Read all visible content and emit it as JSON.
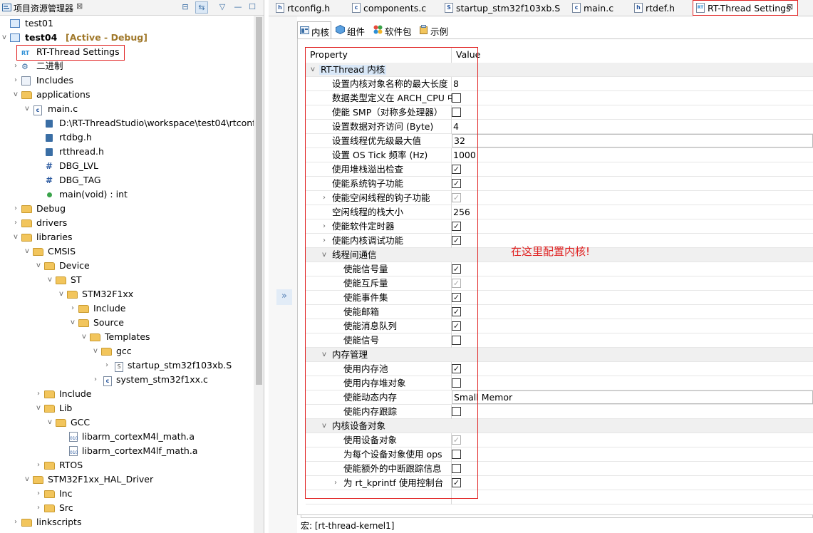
{
  "explorer": {
    "title": "项目资源管理器",
    "close_glyph": "⊠",
    "toolbar": [
      {
        "icon": "collapse-all-icon",
        "glyph": "⊟"
      },
      {
        "icon": "link-with-editor-icon",
        "glyph": "⇆"
      },
      {
        "icon": "view-menu-icon",
        "glyph": "▽"
      },
      {
        "icon": "minimize-icon",
        "glyph": "—"
      },
      {
        "icon": "maximize-icon",
        "glyph": "☐"
      }
    ],
    "tree": {
      "test01": "test01",
      "test04": "test04",
      "test04_status": "[Active - Debug]",
      "rt_settings": "RT-Thread Settings",
      "rt_logo": "RT",
      "binaries": "二进制",
      "includes": "Includes",
      "applications": "applications",
      "main_c": "main.c",
      "rtconfig_path": "D:\\RT-ThreadStudio\\workspace\\test04\\rtconfig",
      "rtdbg_h": "rtdbg.h",
      "rtthread_h": "rtthread.h",
      "dbg_lvl": "DBG_LVL",
      "dbg_tag": "DBG_TAG",
      "main_void": "main(void) : int",
      "debug": "Debug",
      "drivers": "drivers",
      "libraries": "libraries",
      "cmsis": "CMSIS",
      "device": "Device",
      "st": "ST",
      "stm32f1xx": "STM32F1xx",
      "include_sub": "Include",
      "source": "Source",
      "templates": "Templates",
      "gcc_lower": "gcc",
      "startup_s": "startup_stm32f103xb.S",
      "system_c": "system_stm32f1xx.c",
      "include_cmsis": "Include",
      "lib": "Lib",
      "gcc_upper": "GCC",
      "libarm_m4l": "libarm_cortexM4l_math.a",
      "libarm_m4lf": "libarm_cortexM4lf_math.a",
      "rtos": "RTOS",
      "hal_driver": "STM32F1xx_HAL_Driver",
      "inc": "Inc",
      "src": "Src",
      "linkscripts": "linkscripts"
    }
  },
  "editor_tabs": [
    {
      "icon": "h",
      "label": "rtconfig.h"
    },
    {
      "icon": "c",
      "label": "components.c"
    },
    {
      "icon": "S",
      "label": "startup_stm32f103xb.S"
    },
    {
      "icon": "c",
      "label": "main.c"
    },
    {
      "icon": "h",
      "label": "rtdef.h"
    },
    {
      "icon": "RT",
      "label": "RT-Thread Settings",
      "close": "⊠"
    }
  ],
  "settings_tabs": [
    {
      "label": "内核"
    },
    {
      "label": "组件"
    },
    {
      "label": "软件包"
    },
    {
      "label": "示例"
    }
  ],
  "expand_glyph": "»",
  "table": {
    "header_property": "Property",
    "header_value": "Value"
  },
  "rows": [
    {
      "label": "RT-Thread 内核"
    },
    {
      "label": "设置内核对象名称的最大长度",
      "value": "8"
    },
    {
      "label": "数据类型定义在 ARCH_CPU 中"
    },
    {
      "label": "使能 SMP（对称多处理器）"
    },
    {
      "label": "设置数据对齐访问 (Byte)",
      "value": "4"
    },
    {
      "label": "设置线程优先级最大值",
      "value": "32"
    },
    {
      "label": "设置 OS Tick 频率 (Hz)",
      "value": "1000"
    },
    {
      "label": "使用堆栈溢出检查"
    },
    {
      "label": "使能系统钩子功能"
    },
    {
      "label": "使能空闲线程的钩子功能"
    },
    {
      "label": "空闲线程的栈大小",
      "value": "256"
    },
    {
      "label": "使能软件定时器"
    },
    {
      "label": "使能内核调试功能"
    },
    {
      "label": "线程间通信"
    },
    {
      "label": "使能信号量"
    },
    {
      "label": "使能互斥量"
    },
    {
      "label": "使能事件集"
    },
    {
      "label": "使能邮箱"
    },
    {
      "label": "使能消息队列"
    },
    {
      "label": "使能信号"
    },
    {
      "label": "内存管理"
    },
    {
      "label": "使用内存池"
    },
    {
      "label": "使用内存堆对象"
    },
    {
      "label": "使能动态内存",
      "value": "Small Memor"
    },
    {
      "label": "使能内存跟踪"
    },
    {
      "label": "内核设备对象"
    },
    {
      "label": "使用设备对象"
    },
    {
      "label": "为每个设备对象使用 ops"
    },
    {
      "label": "使能额外的中断跟踪信息"
    },
    {
      "label": "为 rt_kprintf 使用控制台"
    }
  ],
  "checkbox_glyph": "✓",
  "annotation": "在这里配置内核!",
  "status": "宏: [rt-thread-kernel1]",
  "colors": {
    "highlight_box": "#e02020",
    "selection": "#d9e8f8",
    "active_status": "#a0782a"
  }
}
